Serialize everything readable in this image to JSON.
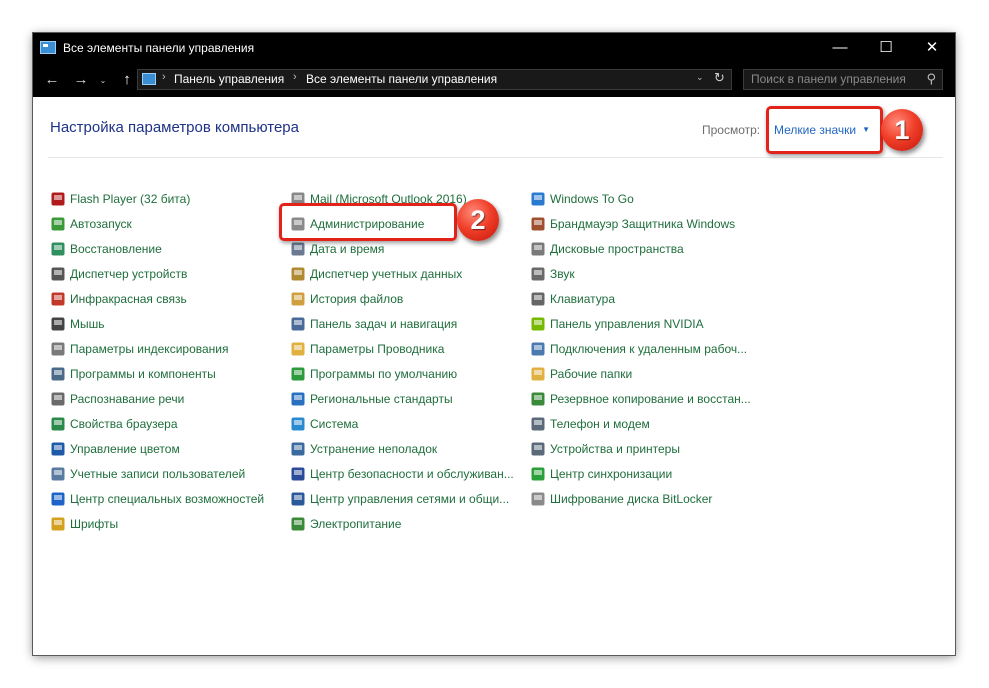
{
  "window": {
    "title": "Все элементы панели управления",
    "controls": {
      "minimize": "—",
      "maximize": "☐",
      "close": "✕"
    }
  },
  "navbar": {
    "back": "←",
    "forward": "→",
    "dropdown": "⌄",
    "up": "↑",
    "breadcrumb": [
      "Панель управления",
      "Все элементы панели управления"
    ],
    "separator": "›",
    "search_placeholder": "Поиск в панели управления"
  },
  "header": {
    "heading": "Настройка параметров компьютера",
    "view_label": "Просмотр:",
    "view_value": "Мелкие значки",
    "view_arrow": "▼"
  },
  "columns": [
    [
      {
        "label": "Flash Player (32 бита)",
        "icon": "flash-player-icon",
        "color": "#b01c1c"
      },
      {
        "label": "Автозапуск",
        "icon": "autoplay-icon",
        "color": "#3a9a3a"
      },
      {
        "label": "Восстановление",
        "icon": "recovery-icon",
        "color": "#2f8f5f"
      },
      {
        "label": "Диспетчер устройств",
        "icon": "device-manager-icon",
        "color": "#555555"
      },
      {
        "label": "Инфракрасная связь",
        "icon": "infrared-icon",
        "color": "#c0392b"
      },
      {
        "label": "Мышь",
        "icon": "mouse-icon",
        "color": "#444444"
      },
      {
        "label": "Параметры индексирования",
        "icon": "indexing-icon",
        "color": "#7a7a7a"
      },
      {
        "label": "Программы и компоненты",
        "icon": "programs-icon",
        "color": "#4a6a8a"
      },
      {
        "label": "Распознавание речи",
        "icon": "speech-icon",
        "color": "#6a6a6a"
      },
      {
        "label": "Свойства браузера",
        "icon": "browser-icon",
        "color": "#2a8a4a"
      },
      {
        "label": "Управление цветом",
        "icon": "color-management-icon",
        "color": "#1e5aa8"
      },
      {
        "label": "Учетные записи пользователей",
        "icon": "user-accounts-icon",
        "color": "#5a7aa0"
      },
      {
        "label": "Центр специальных возможностей",
        "icon": "accessibility-icon",
        "color": "#1e64c8"
      },
      {
        "label": "Шрифты",
        "icon": "fonts-icon",
        "color": "#d4a020"
      }
    ],
    [
      {
        "label": "Mail (Microsoft Outlook 2016)",
        "icon": "mail-icon",
        "color": "#888888"
      },
      {
        "label": "Администрирование",
        "icon": "administration-icon",
        "color": "#8a8a8a"
      },
      {
        "label": "Дата и время",
        "icon": "date-time-icon",
        "color": "#6a7a90"
      },
      {
        "label": "Диспетчер учетных данных",
        "icon": "credential-manager-icon",
        "color": "#b08a30"
      },
      {
        "label": "История файлов",
        "icon": "file-history-icon",
        "color": "#d0a040"
      },
      {
        "label": "Панель задач и навигация",
        "icon": "taskbar-icon",
        "color": "#4a6a9a"
      },
      {
        "label": "Параметры Проводника",
        "icon": "explorer-options-icon",
        "color": "#e0b040"
      },
      {
        "label": "Программы по умолчанию",
        "icon": "default-programs-icon",
        "color": "#2a9a3a"
      },
      {
        "label": "Региональные стандарты",
        "icon": "region-icon",
        "color": "#2a70c0"
      },
      {
        "label": "Система",
        "icon": "system-icon",
        "color": "#2a8ad0"
      },
      {
        "label": "Устранение неполадок",
        "icon": "troubleshooting-icon",
        "color": "#3a6aa0"
      },
      {
        "label": "Центр безопасности и обслуживан...",
        "icon": "security-flag-icon",
        "color": "#2a4a9a"
      },
      {
        "label": "Центр управления сетями и общи...",
        "icon": "network-icon",
        "color": "#2a5a9a"
      },
      {
        "label": "Электропитание",
        "icon": "power-icon",
        "color": "#3a8a3a"
      }
    ],
    [
      {
        "label": "Windows To Go",
        "icon": "windows-to-go-icon",
        "color": "#2a7ad0"
      },
      {
        "label": "Брандмауэр Защитника Windows",
        "icon": "firewall-icon",
        "color": "#a05030"
      },
      {
        "label": "Дисковые пространства",
        "icon": "storage-spaces-icon",
        "color": "#7a7a7a"
      },
      {
        "label": "Звук",
        "icon": "sound-icon",
        "color": "#6a6a6a"
      },
      {
        "label": "Клавиатура",
        "icon": "keyboard-icon",
        "color": "#666666"
      },
      {
        "label": "Панель управления NVIDIA",
        "icon": "nvidia-icon",
        "color": "#76b900"
      },
      {
        "label": "Подключения к удаленным рабоч...",
        "icon": "remote-desktop-icon",
        "color": "#4a7ab0"
      },
      {
        "label": "Рабочие папки",
        "icon": "work-folders-icon",
        "color": "#e0b040"
      },
      {
        "label": "Резервное копирование и восстан...",
        "icon": "backup-icon",
        "color": "#3a8a3a"
      },
      {
        "label": "Телефон и модем",
        "icon": "phone-modem-icon",
        "color": "#5a6a7a"
      },
      {
        "label": "Устройства и принтеры",
        "icon": "devices-printers-icon",
        "color": "#5a6a7a"
      },
      {
        "label": "Центр синхронизации",
        "icon": "sync-center-icon",
        "color": "#2aa03a"
      },
      {
        "label": "Шифрование диска BitLocker",
        "icon": "bitlocker-icon",
        "color": "#8a8a8a"
      }
    ]
  ],
  "annotations": {
    "badge_1": "1",
    "badge_2": "2",
    "accent": "#e2231a"
  }
}
